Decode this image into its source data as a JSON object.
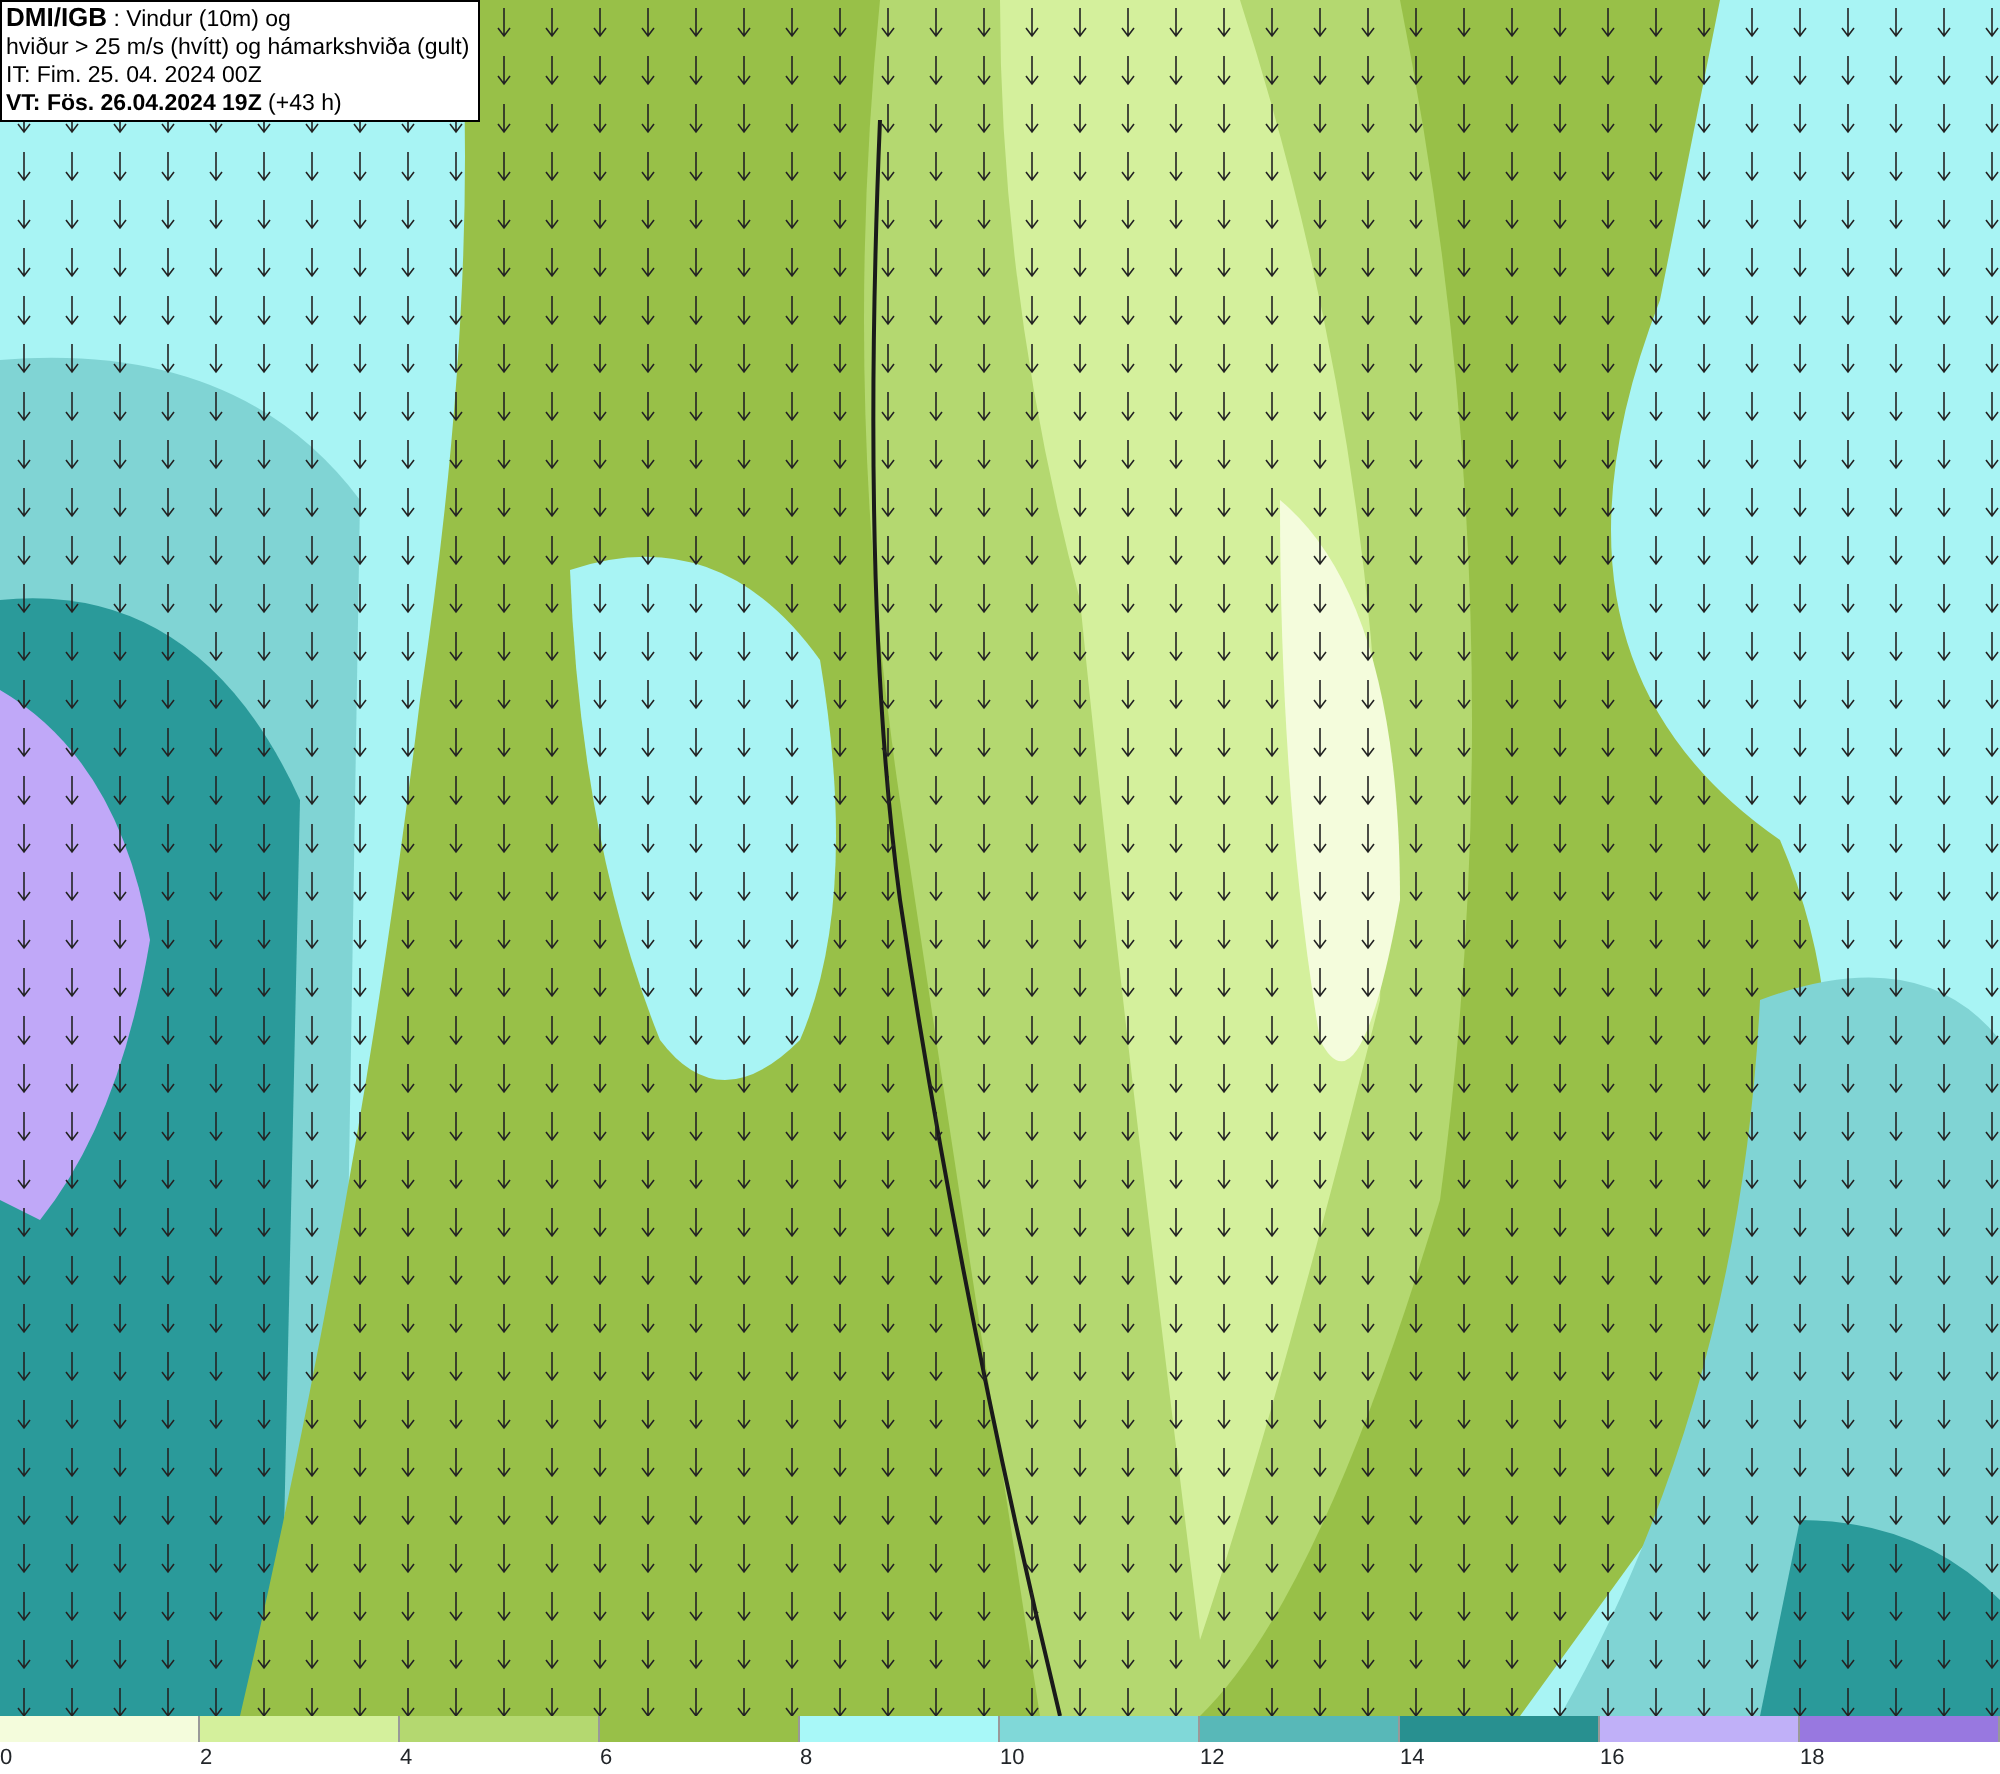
{
  "header": {
    "lines": [
      "**DMI/IGB** : Vindur (10m) og",
      "hviður > 25 m/s (hvítt) og hámarkshviða (gult)",
      "IT: Fim. 25. 04. 2024 00Z",
      "**VT: Fös. 26.04.2024 19Z** (+43 h)"
    ]
  },
  "legend": {
    "segments": [
      {
        "color": "#f4fcdc"
      },
      {
        "color": "#d4f09c"
      },
      {
        "color": "#b4d870"
      },
      {
        "color": "#98c048"
      },
      {
        "color": "#a8f8f8"
      },
      {
        "color": "#80d8d8"
      },
      {
        "color": "#58b8b8"
      },
      {
        "color": "#289090"
      },
      {
        "color": "#c0b0f8"
      },
      {
        "color": "#9878e0"
      }
    ],
    "labels": [
      "0",
      "2",
      "4",
      "6",
      "8",
      "10",
      "12",
      "14",
      "16",
      "18"
    ]
  }
}
